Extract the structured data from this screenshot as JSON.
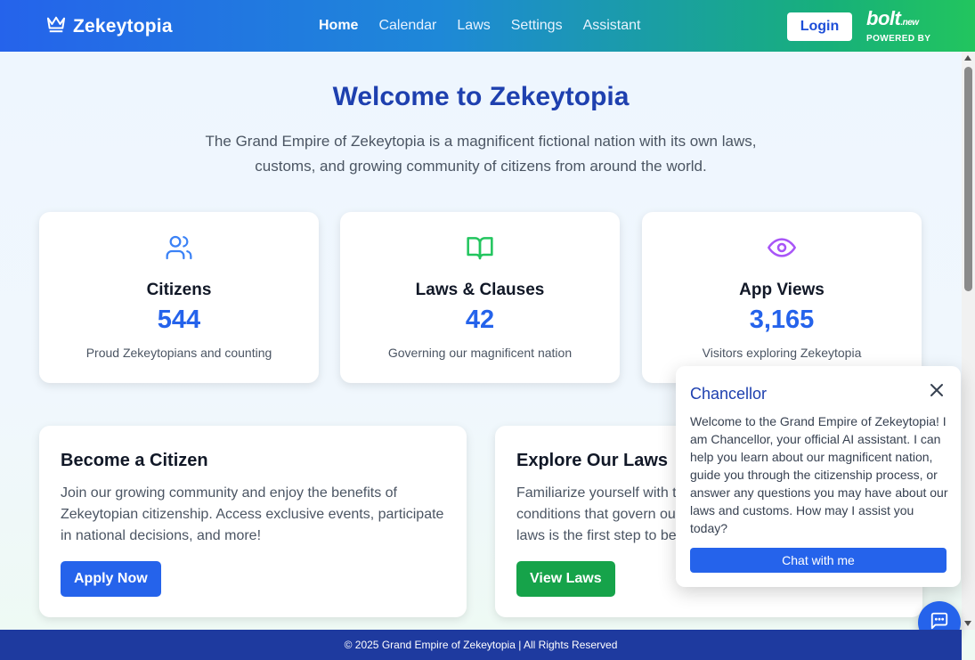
{
  "header": {
    "brand": "Zekeytopia",
    "nav": [
      "Home",
      "Calendar",
      "Laws",
      "Settings",
      "Assistant"
    ],
    "active_nav": "Home",
    "login_label": "Login",
    "bolt_logo": "bolt",
    "bolt_logo_suffix": ".new",
    "bolt_caption": "POWERED BY"
  },
  "hero": {
    "title": "Welcome to Zekeytopia",
    "subtitle": "The Grand Empire of Zekeytopia is a magnificent fictional nation with its own laws, customs, and growing community of citizens from around the world."
  },
  "stats": [
    {
      "icon": "users-icon",
      "title": "Citizens",
      "value": "544",
      "desc": "Proud Zekeytopians and counting",
      "icon_color": "#3b82f6"
    },
    {
      "icon": "book-open-icon",
      "title": "Laws & Clauses",
      "value": "42",
      "desc": "Governing our magnificent nation",
      "icon_color": "#22c55e"
    },
    {
      "icon": "eye-icon",
      "title": "App Views",
      "value": "3,165",
      "desc": "Visitors exploring Zekeytopia",
      "icon_color": "#a855f7"
    }
  ],
  "features": [
    {
      "title": "Become a Citizen",
      "desc": "Join our growing community and enjoy the benefits of Zekeytopian citizenship. Access exclusive events, participate in national decisions, and more!",
      "button": "Apply Now",
      "button_color": "#2563eb"
    },
    {
      "title": "Explore Our Laws",
      "desc": "Familiarize yourself with t... conditions that govern ou... laws is the first step to be...",
      "desc_lines": [
        "Familiarize yourself with t",
        "conditions that govern ou",
        "laws is the first step to be"
      ],
      "button": "View Laws",
      "button_color": "#16a34a"
    }
  ],
  "chat": {
    "title": "Chancellor",
    "message": "Welcome to the Grand Empire of Zekeytopia! I am Chancellor, your official AI assistant. I can help you learn about our magnificent nation, guide you through the citizenship process, or answer any questions you may have about our laws and customs. How may I assist you today?",
    "button": "Chat with me"
  },
  "footer": {
    "text": "© 2025 Grand Empire of Zekeytopia | All Rights Reserved"
  },
  "colors": {
    "primary": "#2563eb",
    "accent_green": "#22c55e",
    "heading_blue": "#1e40af",
    "footer_bg": "#1e3a9f"
  }
}
